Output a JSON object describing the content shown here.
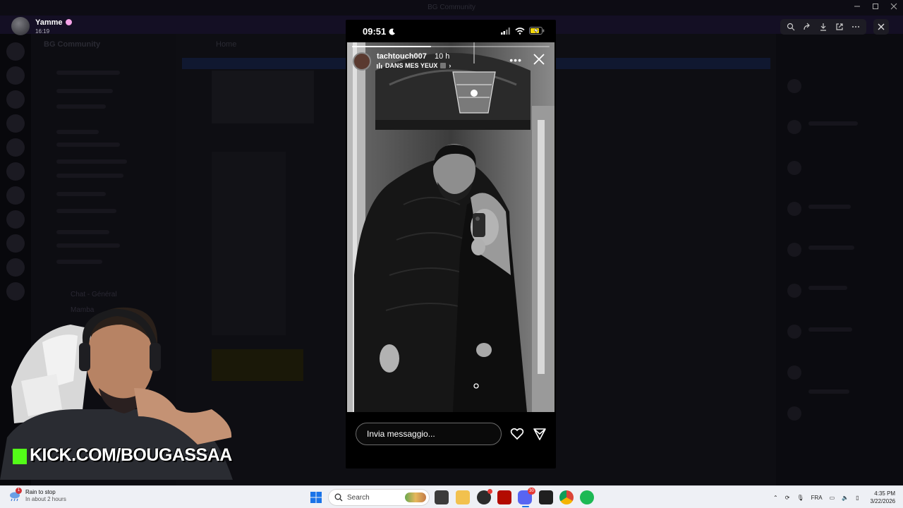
{
  "app": {
    "title": "BG Community",
    "server_name": "BG Community",
    "home_label": "Home",
    "channel_labels": [
      "Chat - Général",
      "Mamba"
    ]
  },
  "viewer": {
    "author_name": "Yamme",
    "author_time": "16:19",
    "tools": [
      "zoom-in-icon",
      "forward-icon",
      "download-icon",
      "open-external-icon",
      "more-icon"
    ]
  },
  "phone": {
    "status_time": "09:51",
    "battery_charging": true
  },
  "story": {
    "username": "tachtouch007",
    "age": "10 h",
    "music": "DANS MES YEUX",
    "progress": 0.4,
    "reply_placeholder": "Invia messaggio...",
    "colors": {
      "accent": "#ffffff"
    }
  },
  "overlay": {
    "kick_url": "KICK.COM/BOUGASSAA",
    "kick_color": "#53fc18"
  },
  "taskbar": {
    "weather_title": "Rain to stop",
    "weather_sub": "In about 2 hours",
    "weather_badge": "1",
    "search_placeholder": "Search",
    "language": "FRA",
    "time": "4:35 PM",
    "date": "3/22/2026",
    "apps": [
      "file-manager",
      "folder",
      "obs",
      "acrobat",
      "discord",
      "terminal",
      "chrome",
      "spotify"
    ],
    "discord_badge": "30"
  }
}
